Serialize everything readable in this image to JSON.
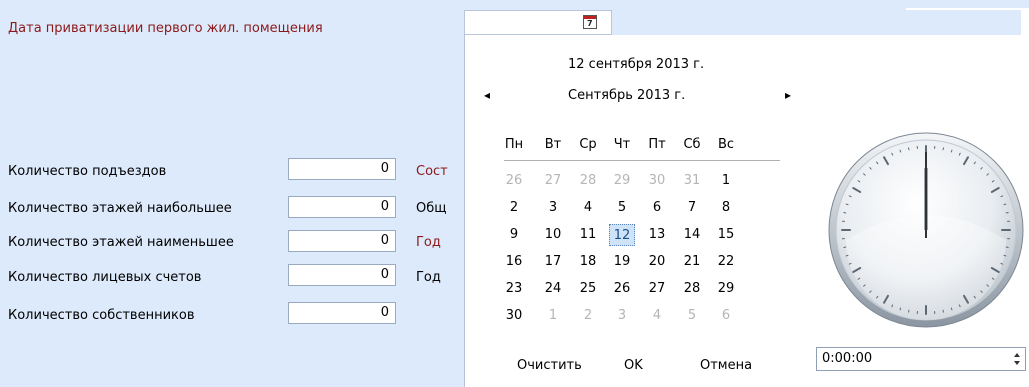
{
  "form": {
    "privatization_label": "Дата приватизации первого жил. помещения",
    "rows": [
      {
        "label": "Количество подъездов",
        "value": "0",
        "side_label": "Сост"
      },
      {
        "label": "Количество этажей наибольшее",
        "value": "0",
        "side_label": "Общ"
      },
      {
        "label": "Количество этажей наименьшее",
        "value": "0",
        "side_label": "Год"
      },
      {
        "label": "Количество лицевых счетов",
        "value": "0",
        "side_label": "Год"
      },
      {
        "label": "Количество собственников",
        "value": "0",
        "side_label": ""
      }
    ]
  },
  "calendar": {
    "button_day": "7",
    "today_text": "12 сентября 2013 г.",
    "month_title": "Сентябрь 2013 г.",
    "prev_arrow": "◂",
    "next_arrow": "▸",
    "weekdays": [
      "Пн",
      "Вт",
      "Ср",
      "Чт",
      "Пт",
      "Сб",
      "Вс"
    ],
    "weeks": [
      [
        "26",
        "27",
        "28",
        "29",
        "30",
        "31",
        "1"
      ],
      [
        "2",
        "3",
        "4",
        "5",
        "6",
        "7",
        "8"
      ],
      [
        "9",
        "10",
        "11",
        "12",
        "13",
        "14",
        "15"
      ],
      [
        "16",
        "17",
        "18",
        "19",
        "20",
        "21",
        "22"
      ],
      [
        "23",
        "24",
        "25",
        "26",
        "27",
        "28",
        "29"
      ],
      [
        "30",
        "1",
        "2",
        "3",
        "4",
        "5",
        "6"
      ]
    ],
    "selected_day": "12",
    "clear_label": "Очистить",
    "ok_label": "OK",
    "cancel_label": "Отмена"
  },
  "time": {
    "value": "0:00:00",
    "hour_hand_angle": 0,
    "minute_hand_angle": 0
  },
  "colors": {
    "background": "#ddeafb",
    "label_red": "#8b1a1a",
    "selected_day_bg": "#cfe3f8"
  }
}
